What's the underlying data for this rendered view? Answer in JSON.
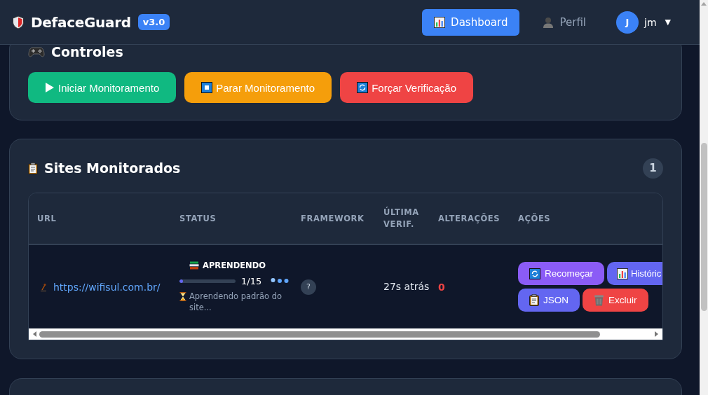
{
  "header": {
    "brand": "DefaceGuard",
    "version": "v3.0",
    "nav": [
      {
        "label": "Dashboard",
        "kind": "dashboard",
        "selected": true
      },
      {
        "label": "Perfil",
        "kind": "profile",
        "selected": false
      }
    ],
    "user": {
      "initial": "J",
      "name": "jm",
      "caret": "▼"
    }
  },
  "controls": {
    "title": "Controles",
    "buttons": [
      {
        "label": "Iniciar Monitoramento",
        "kind": "start"
      },
      {
        "label": "Parar Monitoramento",
        "kind": "stop"
      },
      {
        "label": "Forçar Verificação",
        "kind": "force"
      }
    ]
  },
  "sites": {
    "title": "Sites Monitorados",
    "count": "1",
    "table": {
      "columns": [
        "URL",
        "STATUS",
        "FRAMEWORK",
        "ÚLTIMA VERIF.",
        "ALTERAÇÕES",
        "AÇÕES"
      ],
      "rows": [
        {
          "url": "https://wifisul.com.br/",
          "status": "APRENDENDO",
          "progress": {
            "level": 0.067,
            "reading": "1/15"
          },
          "note": "Aprendendo padrão do site...",
          "framework": "?",
          "last_check": "27s atrás",
          "changes": "0",
          "actions": [
            {
              "label": "Recomeçar",
              "kind": "restart"
            },
            {
              "label": "Históric",
              "kind": "history"
            },
            {
              "label": "JSON",
              "kind": "json"
            },
            {
              "label": "Excluir",
              "kind": "delete"
            }
          ]
        }
      ]
    }
  }
}
